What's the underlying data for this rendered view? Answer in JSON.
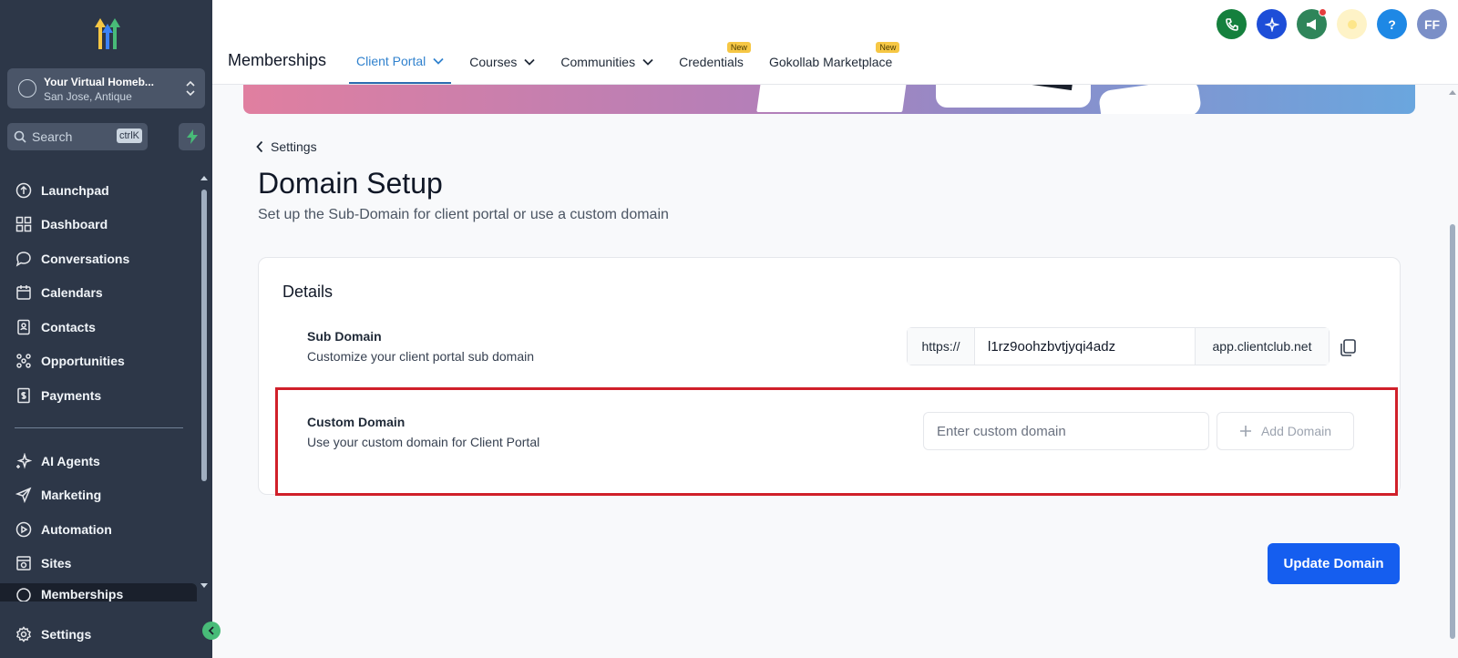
{
  "sidebar": {
    "account": {
      "name": "Your Virtual Homeb...",
      "location": "San Jose, Antique"
    },
    "search": {
      "label": "Search",
      "shortcut": "ctrlK"
    },
    "items": [
      {
        "label": "Launchpad",
        "icon": "launchpad-icon"
      },
      {
        "label": "Dashboard",
        "icon": "dashboard-icon"
      },
      {
        "label": "Conversations",
        "icon": "chat-icon"
      },
      {
        "label": "Calendars",
        "icon": "calendar-icon"
      },
      {
        "label": "Contacts",
        "icon": "contacts-icon"
      },
      {
        "label": "Opportunities",
        "icon": "opportunities-icon"
      },
      {
        "label": "Payments",
        "icon": "payments-icon"
      }
    ],
    "items2": [
      {
        "label": "AI Agents",
        "icon": "sparkle-icon"
      },
      {
        "label": "Marketing",
        "icon": "send-icon"
      },
      {
        "label": "Automation",
        "icon": "automation-icon"
      },
      {
        "label": "Sites",
        "icon": "sites-icon"
      }
    ],
    "partial_item": "Memberships",
    "settings": "Settings"
  },
  "topbar": {
    "title": "Memberships",
    "tabs": [
      {
        "label": "Client Portal",
        "active": true,
        "dropdown": true
      },
      {
        "label": "Courses",
        "dropdown": true
      },
      {
        "label": "Communities",
        "dropdown": true
      },
      {
        "label": "Credentials",
        "badge": "New"
      },
      {
        "label": "Gokollab Marketplace",
        "badge": "New"
      }
    ],
    "avatar": "FF",
    "help": "?"
  },
  "page": {
    "back": "Settings",
    "title": "Domain Setup",
    "subtitle": "Set up the Sub-Domain for client portal or use a custom domain",
    "details_title": "Details",
    "subdomain": {
      "title": "Sub Domain",
      "desc": "Customize your client portal sub domain",
      "prefix": "https://",
      "value": "l1rz9oohzbvtjyqi4adz",
      "suffix": "app.clientclub.net"
    },
    "custom": {
      "title": "Custom Domain",
      "desc": "Use your custom domain for Client Portal",
      "placeholder": "Enter custom domain",
      "add_label": "Add Domain"
    },
    "update_label": "Update Domain"
  },
  "colors": {
    "accent": "#155eef",
    "highlight": "#d0202a",
    "sidebar": "#2d3748"
  }
}
